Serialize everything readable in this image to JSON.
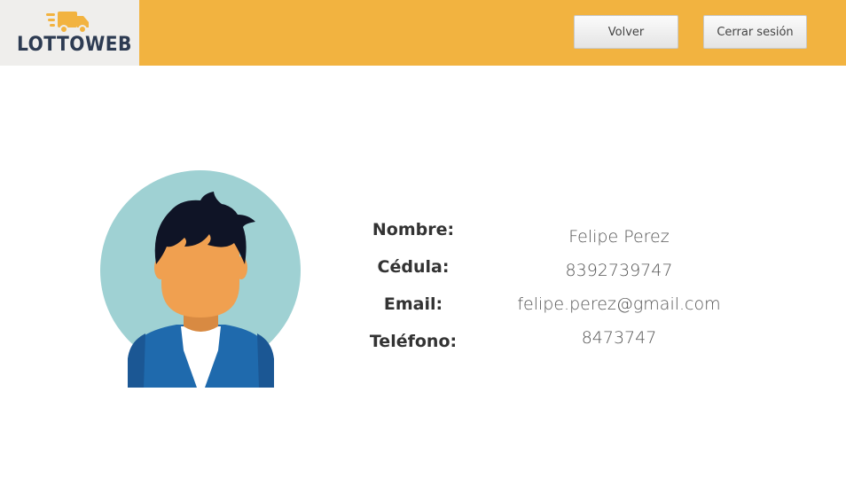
{
  "header": {
    "logo_text": "LOTTOWEB",
    "buttons": {
      "back_label": "Volver",
      "logout_label": "Cerrar sesión"
    }
  },
  "profile": {
    "fields": [
      {
        "label": "Nombre:",
        "value": "Felipe Perez"
      },
      {
        "label": "Cédula:",
        "value": "8392739747"
      },
      {
        "label": "Email:",
        "value": "felipe.perez@gmail.com"
      },
      {
        "label": "Teléfono:",
        "value": "8473747"
      }
    ]
  },
  "colors": {
    "header_bg": "#f2b340",
    "logo_bg": "#efeeec",
    "logo_text": "#2d3b52",
    "avatar_circle": "#9fd1d3",
    "avatar_jacket": "#1f6aad",
    "avatar_skin": "#f0a050",
    "avatar_hair": "#0f1426"
  },
  "icons": {
    "logo": "delivery-truck-icon",
    "avatar": "user-avatar-icon"
  }
}
